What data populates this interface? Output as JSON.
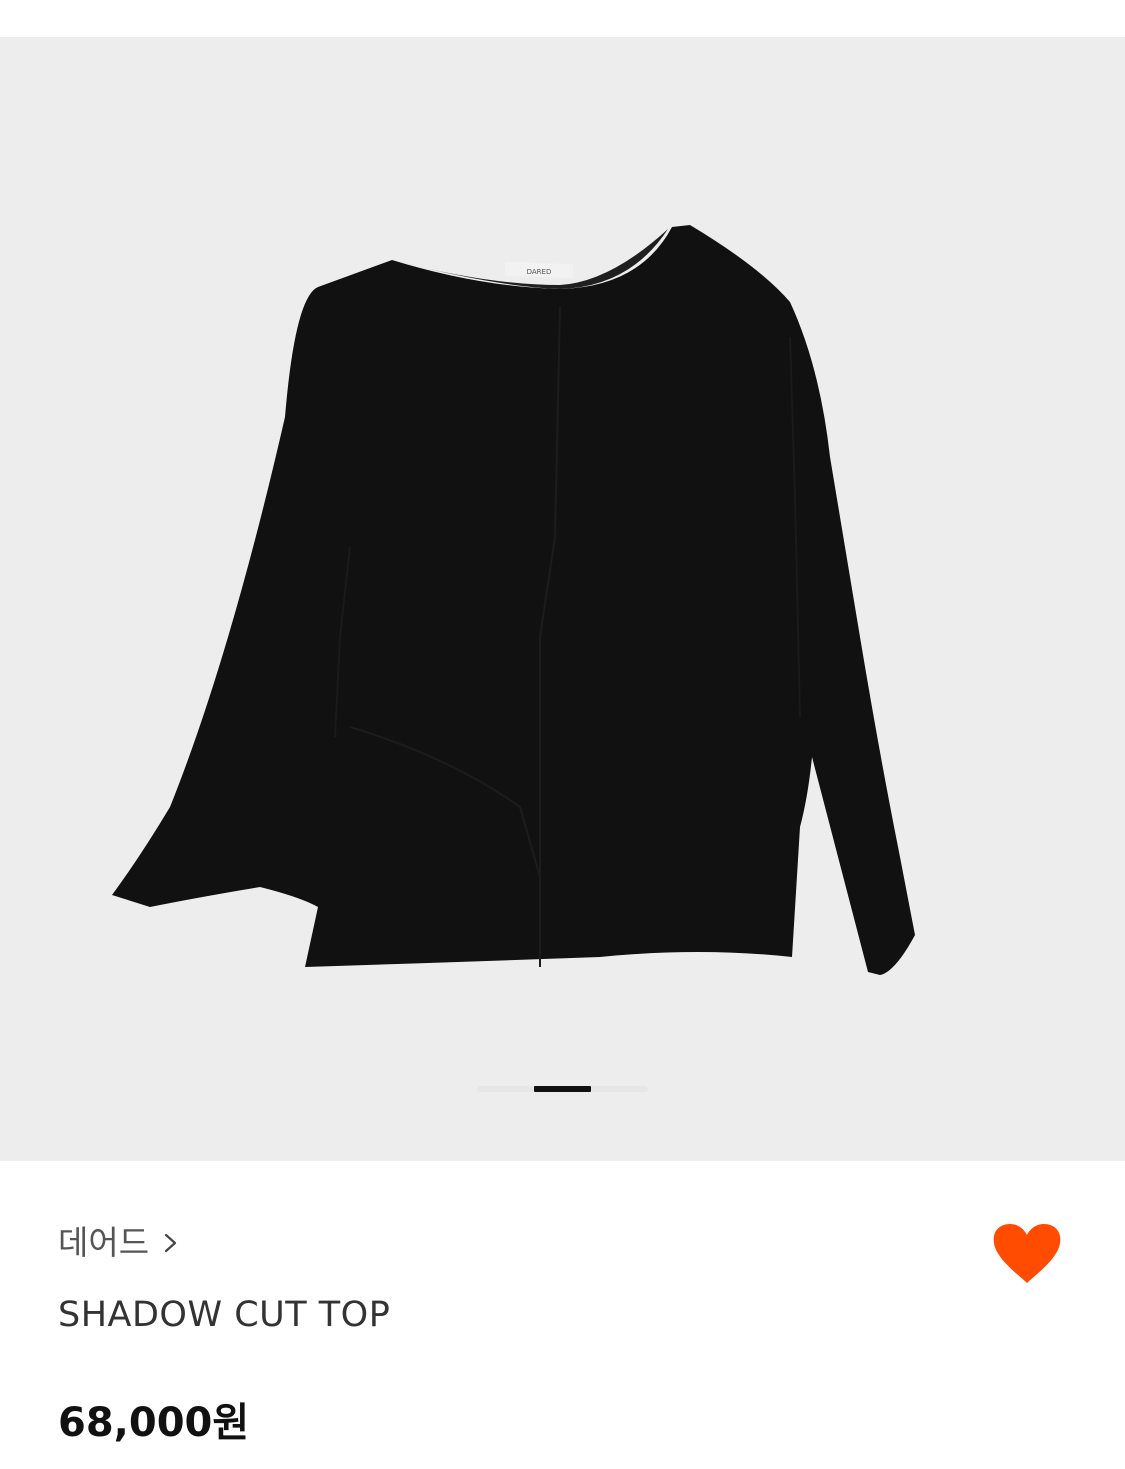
{
  "product": {
    "brand": "데어드",
    "name": "SHADOW CUT TOP",
    "price": "68,000원",
    "image_label_text": "DARED"
  },
  "carousel": {
    "total_slides": 3,
    "active_slide": 2
  },
  "wishlist": {
    "liked": true,
    "color": "#FF4C00"
  },
  "icons": {
    "brand_chevron": "chevron-right-icon",
    "wishlist": "heart-icon"
  }
}
